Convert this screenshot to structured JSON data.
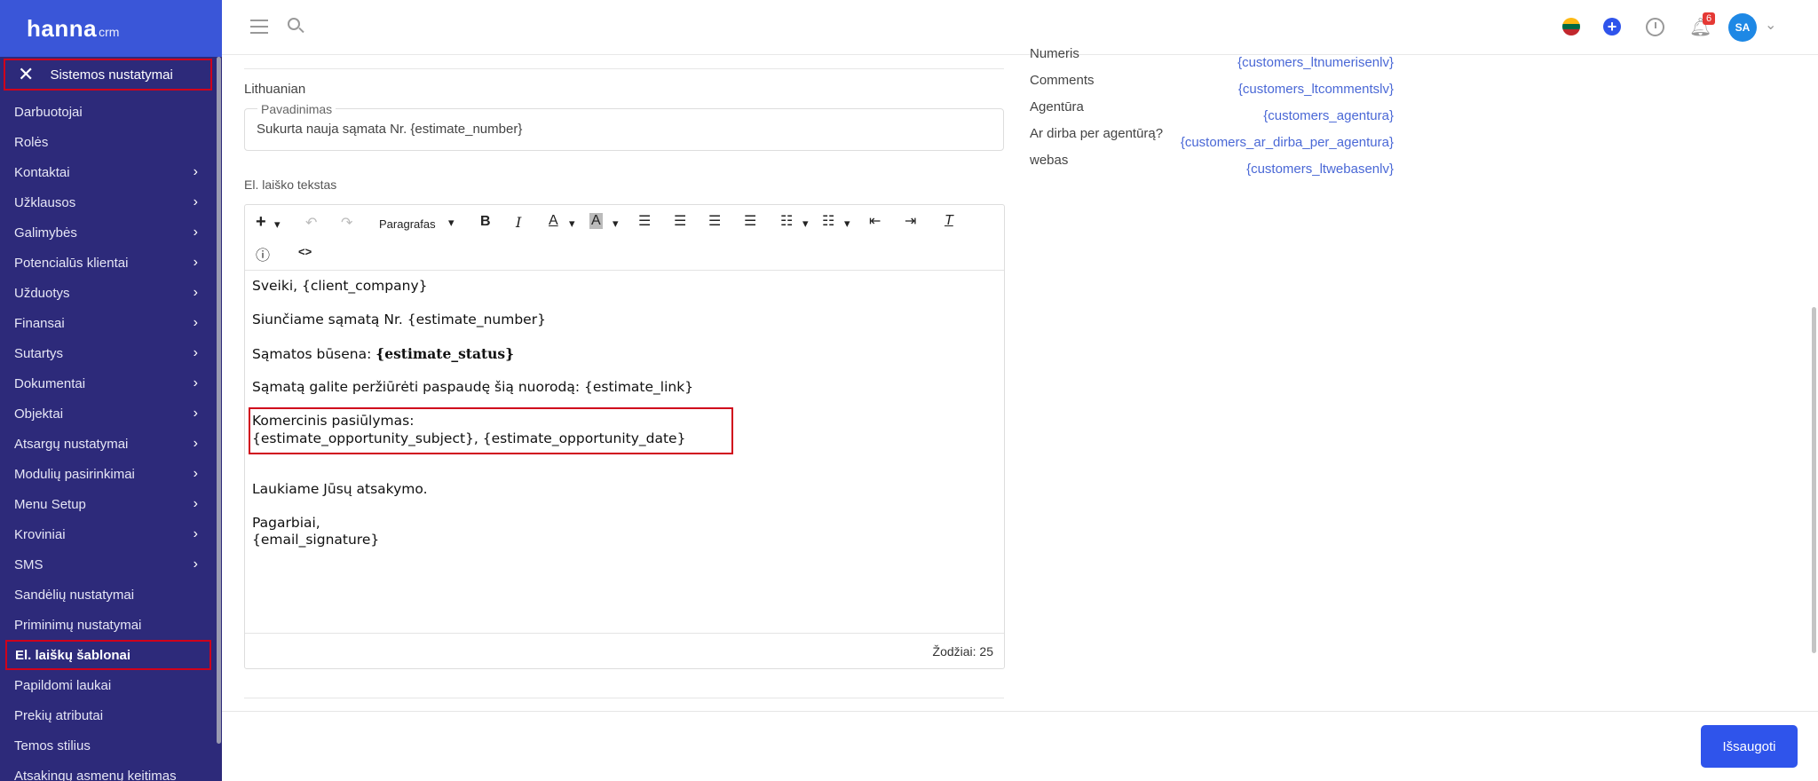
{
  "brand": {
    "name": "hanna",
    "suffix": "crm"
  },
  "sidebar": {
    "section_title": "Sistemos nustatymai",
    "items": [
      {
        "label": "Darbuotojai",
        "chevron": false
      },
      {
        "label": "Rolės",
        "chevron": false
      },
      {
        "label": "Kontaktai",
        "chevron": true
      },
      {
        "label": "Užklausos",
        "chevron": true
      },
      {
        "label": "Galimybės",
        "chevron": true
      },
      {
        "label": "Potencialūs klientai",
        "chevron": true
      },
      {
        "label": "Užduotys",
        "chevron": true
      },
      {
        "label": "Finansai",
        "chevron": true
      },
      {
        "label": "Sutartys",
        "chevron": true
      },
      {
        "label": "Dokumentai",
        "chevron": true
      },
      {
        "label": "Objektai",
        "chevron": true
      },
      {
        "label": "Atsargų nustatymai",
        "chevron": true
      },
      {
        "label": "Modulių pasirinkimai",
        "chevron": true
      },
      {
        "label": "Menu Setup",
        "chevron": true
      },
      {
        "label": "Kroviniai",
        "chevron": true
      },
      {
        "label": "SMS",
        "chevron": true
      },
      {
        "label": "Sandėlių nustatymai",
        "chevron": false
      },
      {
        "label": "Priminimų nustatymai",
        "chevron": false
      },
      {
        "label": "El. laiškų šablonai",
        "chevron": false,
        "active": true
      },
      {
        "label": "Papildomi laukai",
        "chevron": false
      },
      {
        "label": "Prekių atributai",
        "chevron": false
      },
      {
        "label": "Temos stilius",
        "chevron": false
      },
      {
        "label": "Atsakingų asmenų keitimas",
        "chevron": false
      }
    ]
  },
  "topbar": {
    "notifications_count": "6",
    "avatar_initials": "SA"
  },
  "form": {
    "language": "Lithuanian",
    "subject_label": "Pavadinimas",
    "subject_value": "Sukurta nauja sąmata Nr. {estimate_number}",
    "body_label": "El. laiško tekstas",
    "toolbar": {
      "paragraph": "Paragrafas"
    },
    "body_lines": [
      "Sveiki, {client_company}",
      "Siunčiame sąmatą Nr. {estimate_number}",
      "Sąmatos būsena: ",
      "{estimate_status}",
      "Sąmatą galite peržiūrėti paspaudę šią nuorodą: {estimate_link}",
      "Komercinis pasiūlymas:",
      "{estimate_opportunity_subject}, {estimate_opportunity_date}",
      "Laukiame Jūsų atsakymo.",
      "Pagarbiai,",
      "{email_signature}"
    ],
    "word_count": "Žodžiai: 25"
  },
  "variables": {
    "labels": [
      "Numeris",
      "Comments",
      "Agentūra",
      "Ar dirba per agentūrą?",
      "webas"
    ],
    "values": [
      "{customers_ltnumerisenlv}",
      "{customers_ltcommentslv}",
      "{customers_agentura}",
      "{customers_ar_dirba_per_agentura}",
      "{customers_ltwebasenlv}"
    ]
  },
  "footer": {
    "save_label": "Išsaugoti"
  }
}
